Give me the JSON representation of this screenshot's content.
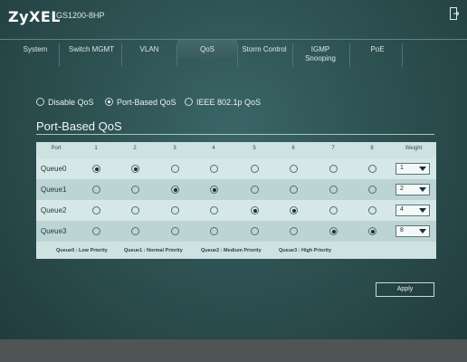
{
  "header": {
    "brand": "ZyXEL",
    "model": "GS1200-8HP",
    "logout_icon": "logout-icon"
  },
  "nav": {
    "items": [
      {
        "label": "System"
      },
      {
        "label": "Switch MGMT"
      },
      {
        "label": "VLAN"
      },
      {
        "label": "QoS"
      },
      {
        "label": "Storm Control"
      },
      {
        "label": "IGMP\nSnooping"
      },
      {
        "label": "PoE"
      }
    ],
    "active": "QoS"
  },
  "qos_mode": {
    "options": [
      "Disable QoS",
      "Port-Based QoS",
      "IEEE 802.1p QoS"
    ],
    "selected": "Port-Based QoS"
  },
  "section": {
    "title": "Port-Based QoS"
  },
  "table": {
    "port_header": "Port",
    "weight_header": "Weight",
    "ports": [
      "1",
      "2",
      "3",
      "4",
      "5",
      "6",
      "7",
      "8"
    ],
    "queues": [
      {
        "label": "Queue0",
        "weight": "1"
      },
      {
        "label": "Queue1",
        "weight": "2"
      },
      {
        "label": "Queue2",
        "weight": "4"
      },
      {
        "label": "Queue3",
        "weight": "8"
      }
    ],
    "port_assignment": {
      "1": "Queue0",
      "2": "Queue0",
      "3": "Queue1",
      "4": "Queue1",
      "5": "Queue2",
      "6": "Queue2",
      "7": "Queue3",
      "8": "Queue3"
    },
    "legend": [
      "Queue0 : Low Priority",
      "Queue1 : Normal Priority",
      "Queue2 : Medium Priority",
      "Queue3 : High Priority"
    ]
  },
  "actions": {
    "apply": "Apply"
  },
  "colors": {
    "background": "#2b4a4b",
    "panel": "#cfe2e2",
    "row_alt": "#bcd4d4",
    "footer": "#4f5455"
  }
}
